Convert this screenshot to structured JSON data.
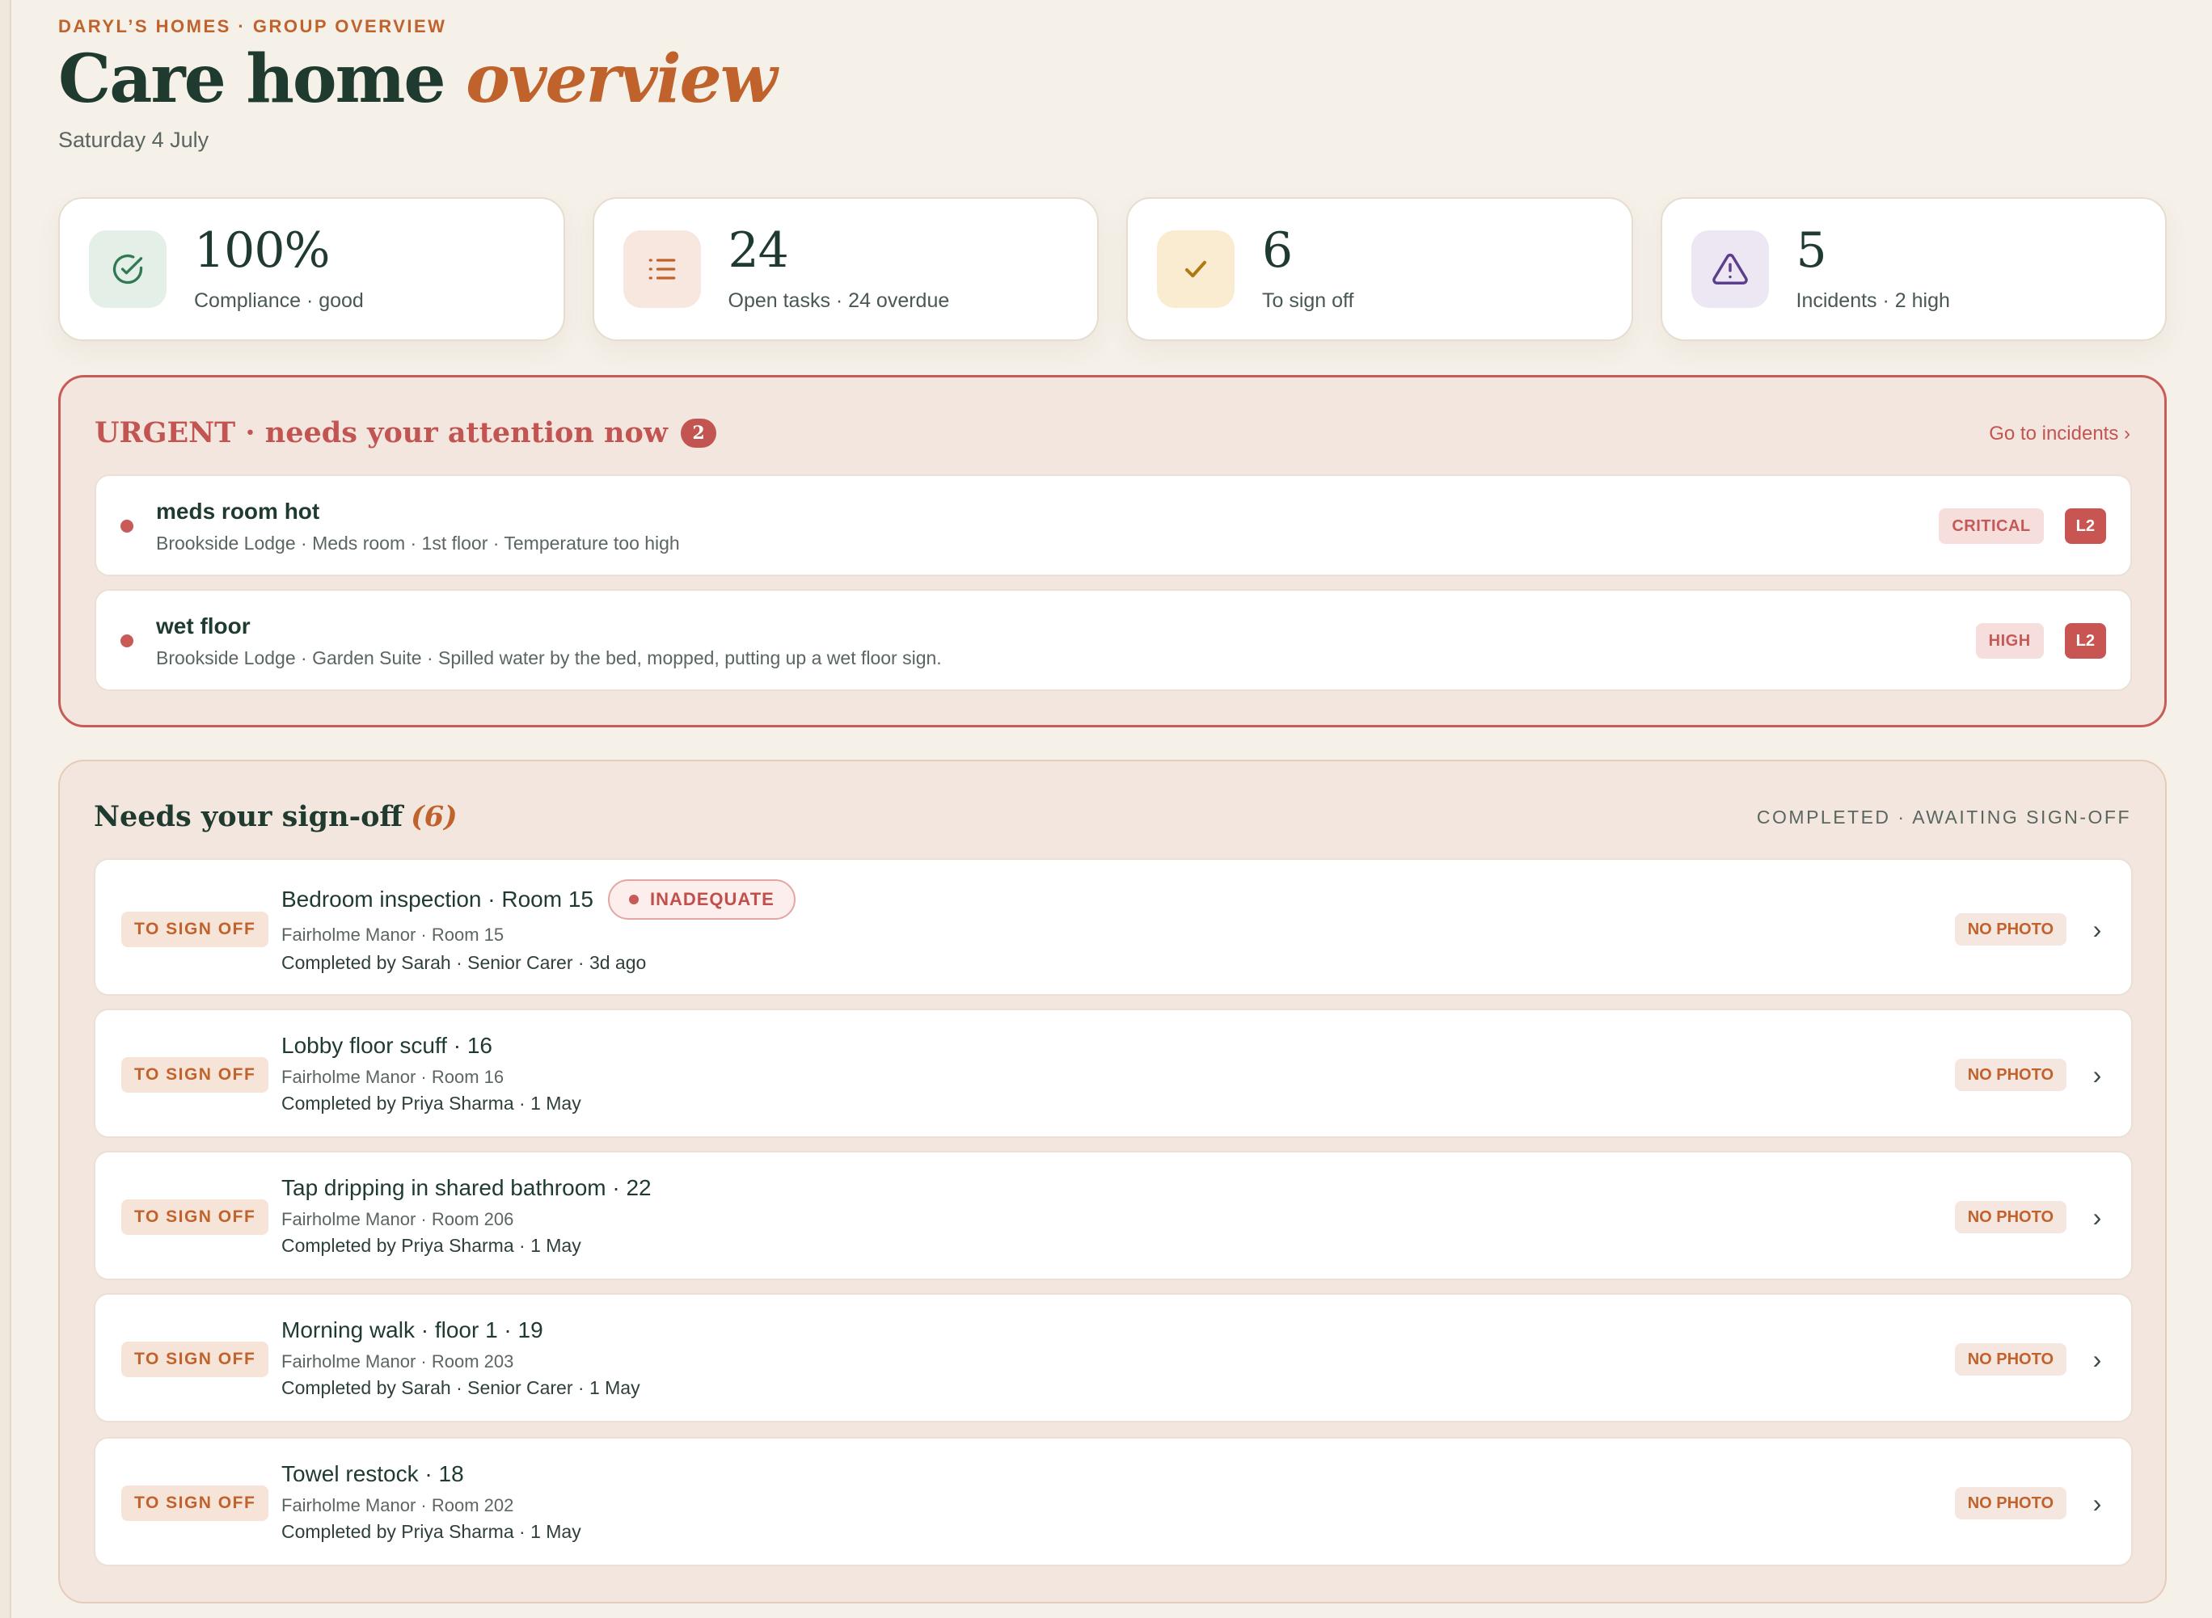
{
  "header": {
    "eyebrow": "DARYL’S HOMES · GROUP OVERVIEW",
    "title_main": "Care home",
    "title_accent": "overview",
    "date": "Saturday 4 July"
  },
  "stats": [
    {
      "icon": "check-circle-icon",
      "value": "100%",
      "label": "Compliance · good",
      "tint": "#e3efe7",
      "color": "#2f7a52"
    },
    {
      "icon": "list-icon",
      "value": "24",
      "label": "Open tasks · 24 overdue",
      "tint": "#f8e7de",
      "color": "#c0622c"
    },
    {
      "icon": "checkmark-icon",
      "value": "6",
      "label": "To sign off",
      "tint": "#faecd0",
      "color": "#b07a12"
    },
    {
      "icon": "warning-triangle-icon",
      "value": "5",
      "label": "Incidents · 2 high",
      "tint": "#ede7f3",
      "color": "#5b3f8c"
    }
  ],
  "urgent": {
    "title": "URGENT · needs your attention now",
    "count": "2",
    "link": "Go to incidents ›",
    "items": [
      {
        "title": "meds room hot",
        "subtitle": "Brookside Lodge · Meds room · 1st floor · Temperature too high",
        "severity": "CRITICAL",
        "level": "L2"
      },
      {
        "title": "wet floor",
        "subtitle": "Brookside Lodge · Garden Suite · Spilled water by the bed, mopped, putting up a wet floor sign.",
        "severity": "HIGH",
        "level": "L2"
      }
    ]
  },
  "signoff": {
    "title": "Needs your sign-off",
    "count": "(6)",
    "meta": "COMPLETED · AWAITING SIGN-OFF",
    "items": [
      {
        "tag": "TO SIGN OFF",
        "title": "Bedroom inspection · Room 15",
        "quality": "INADEQUATE",
        "location": "Fairholme Manor · Room 15",
        "completed": "Completed by Sarah · Senior Carer · 3d ago",
        "photo": "NO PHOTO",
        "chevron": "›"
      },
      {
        "tag": "TO SIGN OFF",
        "title": "Lobby floor scuff · 16",
        "location": "Fairholme Manor · Room 16",
        "completed": "Completed by Priya Sharma · 1 May",
        "photo": "NO PHOTO",
        "chevron": "›"
      },
      {
        "tag": "TO SIGN OFF",
        "title": "Tap dripping in shared bathroom · 22",
        "location": "Fairholme Manor · Room 206",
        "completed": "Completed by Priya Sharma · 1 May",
        "photo": "NO PHOTO",
        "chevron": "›"
      },
      {
        "tag": "TO SIGN OFF",
        "title": "Morning walk · floor 1 · 19",
        "location": "Fairholme Manor · Room 203",
        "completed": "Completed by Sarah · Senior Carer · 1 May",
        "photo": "NO PHOTO",
        "chevron": "›"
      },
      {
        "tag": "TO SIGN OFF",
        "title": "Towel restock · 18",
        "location": "Fairholme Manor · Room 202",
        "completed": "Completed by Priya Sharma · 1 May",
        "photo": "NO PHOTO",
        "chevron": "›"
      }
    ]
  }
}
